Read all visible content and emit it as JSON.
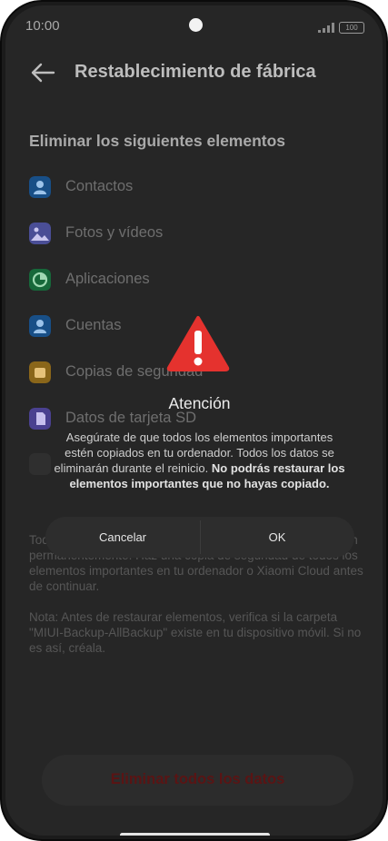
{
  "status_bar": {
    "time": "10:00",
    "battery": "100"
  },
  "header": {
    "title": "Restablecimiento de fábrica"
  },
  "section_title": "Eliminar los siguientes elementos",
  "items": [
    {
      "label": "Contactos",
      "icon": "contacts-icon",
      "color": "#1c6fc2"
    },
    {
      "label": "Fotos y vídeos",
      "icon": "photos-icon",
      "color": "#6b6fd9"
    },
    {
      "label": "Aplicaciones",
      "icon": "apps-icon",
      "color": "#1f9b4a"
    },
    {
      "label": "Cuentas",
      "icon": "accounts-icon",
      "color": "#1f6fc4"
    },
    {
      "label": "Copias de seguridad",
      "icon": "backup-icon",
      "color": "#d19a22"
    },
    {
      "label": "Datos de tarjeta SD",
      "icon": "sd-card-icon",
      "color": "#6a5fd0"
    }
  ],
  "info_text": "Todos los elementos enumerados anteriormente se borrarán permanentemente. Haz una copia de seguridad de todos los elementos importantes en tu ordenador o Xiaomi Cloud antes de continuar.",
  "note_text": "Nota: Antes de restaurar elementos, verifica si la carpeta \"MIUI-Backup-AllBackup\" existe en tu dispositivo móvil. Si no es así, créala.",
  "erase_button": "Eliminar todos los datos",
  "dialog": {
    "title": "Atención",
    "body_plain": "Asegúrate de que todos los elementos importantes estén copiados en tu ordenador. Todos los datos se eliminarán durante el reinicio. ",
    "body_bold": "No podrás restaurar los elementos importantes que no hayas copiado.",
    "cancel": "Cancelar",
    "ok": "OK",
    "warning_color": "#e5322e"
  }
}
